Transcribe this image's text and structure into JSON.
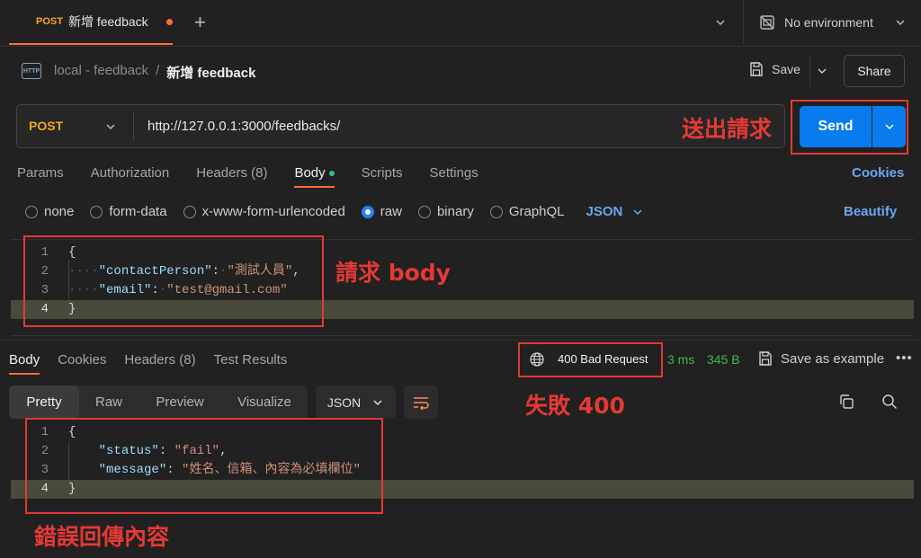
{
  "tab": {
    "method": "POST",
    "name": "新增 feedback"
  },
  "environment": {
    "label": "No environment"
  },
  "breadcrumb": {
    "icon_text": "HTTP",
    "parent": "local - feedback",
    "separator": "/",
    "current": "新增 feedback"
  },
  "actions": {
    "save_label": "Save",
    "share_label": "Share"
  },
  "request": {
    "method": "POST",
    "url": "http://127.0.0.1:3000/feedbacks/",
    "send_label": "Send"
  },
  "request_tabs": [
    {
      "label": "Params"
    },
    {
      "label": "Authorization"
    },
    {
      "label": "Headers (8)"
    },
    {
      "label": "Body"
    },
    {
      "label": "Scripts"
    },
    {
      "label": "Settings"
    }
  ],
  "cookies_label": "Cookies",
  "body_types": [
    "none",
    "form-data",
    "x-www-form-urlencoded",
    "raw",
    "binary",
    "GraphQL"
  ],
  "body_format": "JSON",
  "beautify_label": "Beautify",
  "request_body": {
    "line_numbers": [
      "1",
      "2",
      "3",
      "4"
    ],
    "open": "{",
    "key1": "\"contactPerson\"",
    "val1": "\"測試人員\"",
    "key2": "\"email\"",
    "val2": "\"test@gmail.com\"",
    "close": "}"
  },
  "response_tabs": [
    {
      "label": "Body"
    },
    {
      "label": "Cookies"
    },
    {
      "label": "Headers (8)"
    },
    {
      "label": "Test Results"
    }
  ],
  "response_meta": {
    "status": "400 Bad Request",
    "time": "3 ms",
    "size": "345 B",
    "save_example": "Save as example",
    "more": "•••"
  },
  "view_modes": [
    "Pretty",
    "Raw",
    "Preview",
    "Visualize"
  ],
  "response_format": "JSON",
  "response_body": {
    "line_numbers": [
      "1",
      "2",
      "3",
      "4"
    ],
    "open": "{",
    "key1": "\"status\"",
    "val1": "\"fail\"",
    "key2": "\"message\"",
    "val2": "\"姓名、信箱、內容為必填欄位\"",
    "close": "}"
  },
  "annotations": {
    "send": "送出請求",
    "body": "請求 body",
    "status": "失敗 400",
    "response": "錯誤回傳內容"
  },
  "colors": {
    "accent": "#ff6c37",
    "send": "#097bed",
    "annotation": "#e53935",
    "method": "#f5a623",
    "link": "#6aa6f2",
    "success": "#3fb950"
  }
}
